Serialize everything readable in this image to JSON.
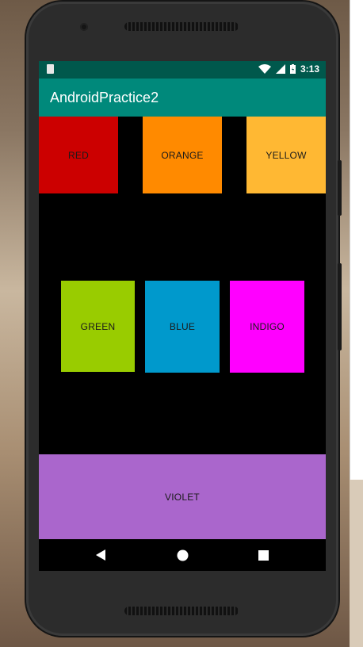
{
  "app": {
    "title": "AndroidPractice2"
  },
  "status": {
    "time": "3:13"
  },
  "colors": {
    "status_bar": "#00584c",
    "app_bar": "#00897b",
    "red": "#cc0000",
    "orange": "#ff8a00",
    "yellow": "#ffb833",
    "green": "#99cc00",
    "blue": "#0099cc",
    "indigo": "#ff00ff",
    "violet": "#aa66cc"
  },
  "boxes": {
    "red": "RED",
    "orange": "ORANGE",
    "yellow": "YELLOW",
    "green": "GREEN",
    "blue": "BLUE",
    "indigo": "INDIGO",
    "violet": "VIOLET"
  },
  "nav": {
    "back": "back-icon",
    "home": "home-icon",
    "recents": "recents-icon"
  }
}
